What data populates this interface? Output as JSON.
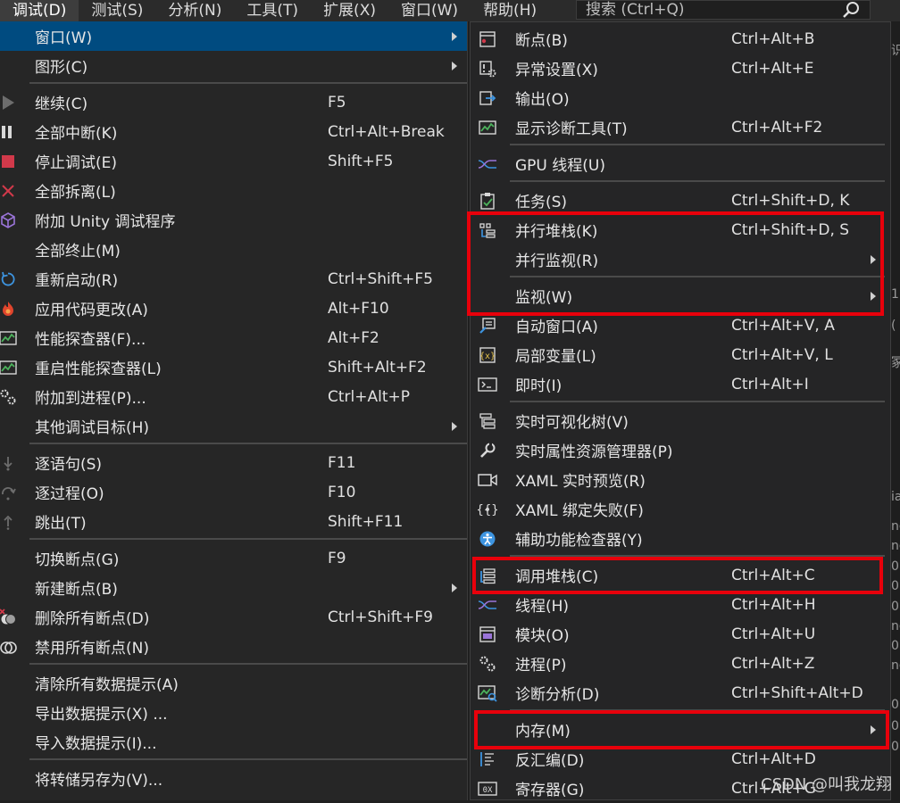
{
  "menubar": {
    "items": [
      {
        "label": "调试(D)",
        "active": true
      },
      {
        "label": "测试(S)"
      },
      {
        "label": "分析(N)"
      },
      {
        "label": "工具(T)"
      },
      {
        "label": "扩展(X)"
      },
      {
        "label": "窗口(W)"
      },
      {
        "label": "帮助(H)"
      }
    ],
    "search_placeholder": "搜索 (Ctrl+Q)"
  },
  "debug_menu": {
    "items": [
      {
        "label": "窗口(W)",
        "shortcut": "",
        "submenu": true,
        "highlight": true,
        "icon": ""
      },
      {
        "label": "图形(C)",
        "shortcut": "",
        "submenu": true,
        "icon": ""
      },
      {
        "label": "继续(C)",
        "shortcut": "F5",
        "icon": "play-icon"
      },
      {
        "label": "全部中断(K)",
        "shortcut": "Ctrl+Alt+Break",
        "icon": "pause-icon"
      },
      {
        "label": "停止调试(E)",
        "shortcut": "Shift+F5",
        "icon": "stop-icon"
      },
      {
        "label": "全部拆离(L)",
        "shortcut": "",
        "icon": "detach-icon"
      },
      {
        "label": "附加 Unity 调试程序",
        "shortcut": "",
        "icon": "unity-cube-icon"
      },
      {
        "label": "全部终止(M)",
        "shortcut": "",
        "icon": ""
      },
      {
        "label": "重新启动(R)",
        "shortcut": "Ctrl+Shift+F5",
        "icon": "restart-icon"
      },
      {
        "label": "应用代码更改(A)",
        "shortcut": "Alt+F10",
        "icon": "hot-reload-flame-icon"
      },
      {
        "label": "性能探查器(F)...",
        "shortcut": "Alt+F2",
        "icon": "profiler-chart-icon"
      },
      {
        "label": "重启性能探查器(L)",
        "shortcut": "Shift+Alt+F2",
        "icon": "profiler-chart-icon"
      },
      {
        "label": "附加到进程(P)...",
        "shortcut": "Ctrl+Alt+P",
        "icon": "gears-icon"
      },
      {
        "label": "其他调试目标(H)",
        "shortcut": "",
        "submenu": true,
        "icon": ""
      },
      {
        "label": "逐语句(S)",
        "shortcut": "F11",
        "icon": "step-into-icon"
      },
      {
        "label": "逐过程(O)",
        "shortcut": "F10",
        "icon": "step-over-icon"
      },
      {
        "label": "跳出(T)",
        "shortcut": "Shift+F11",
        "icon": "step-out-icon"
      },
      {
        "label": "切换断点(G)",
        "shortcut": "F9",
        "icon": ""
      },
      {
        "label": "新建断点(B)",
        "shortcut": "",
        "submenu": true,
        "icon": ""
      },
      {
        "label": "删除所有断点(D)",
        "shortcut": "Ctrl+Shift+F9",
        "icon": "delete-breakpoints-icon"
      },
      {
        "label": "禁用所有断点(N)",
        "shortcut": "",
        "icon": "disable-breakpoints-icon"
      },
      {
        "label": "清除所有数据提示(A)",
        "shortcut": "",
        "icon": ""
      },
      {
        "label": "导出数据提示(X) ...",
        "shortcut": "",
        "icon": ""
      },
      {
        "label": "导入数据提示(I)...",
        "shortcut": "",
        "icon": ""
      },
      {
        "label": "将转储另存为(V)...",
        "shortcut": "",
        "icon": ""
      }
    ]
  },
  "window_submenu": {
    "items": [
      {
        "label": "断点(B)",
        "shortcut": "Ctrl+Alt+B",
        "icon": "breakpoints-window-icon"
      },
      {
        "label": "异常设置(X)",
        "shortcut": "Ctrl+Alt+E",
        "icon": "exception-settings-icon"
      },
      {
        "label": "输出(O)",
        "shortcut": "",
        "icon": "output-icon"
      },
      {
        "label": "显示诊断工具(T)",
        "shortcut": "Ctrl+Alt+F2",
        "icon": "diagnostic-tools-icon"
      },
      {
        "label": "GPU 线程(U)",
        "shortcut": "",
        "icon": "gpu-threads-icon"
      },
      {
        "label": "任务(S)",
        "shortcut": "Ctrl+Shift+D, K",
        "icon": "tasks-clipboard-icon"
      },
      {
        "label": "并行堆栈(K)",
        "shortcut": "Ctrl+Shift+D, S",
        "icon": "parallel-stacks-icon"
      },
      {
        "label": "并行监视(R)",
        "shortcut": "",
        "submenu": true,
        "icon": ""
      },
      {
        "label": "监视(W)",
        "shortcut": "",
        "submenu": true,
        "icon": ""
      },
      {
        "label": "自动窗口(A)",
        "shortcut": "Ctrl+Alt+V, A",
        "icon": "autos-window-icon"
      },
      {
        "label": "局部变量(L)",
        "shortcut": "Ctrl+Alt+V, L",
        "icon": "locals-icon"
      },
      {
        "label": "即时(I)",
        "shortcut": "Ctrl+Alt+I",
        "icon": "immediate-window-icon"
      },
      {
        "label": "实时可视化树(V)",
        "shortcut": "",
        "icon": "live-visual-tree-icon"
      },
      {
        "label": "实时属性资源管理器(P)",
        "shortcut": "",
        "icon": "property-explorer-wrench-icon"
      },
      {
        "label": "XAML 实时预览(R)",
        "shortcut": "",
        "icon": "camera-preview-icon"
      },
      {
        "label": "XAML 绑定失败(F)",
        "shortcut": "",
        "icon": "binding-failures-icon"
      },
      {
        "label": "辅助功能检查器(Y)",
        "shortcut": "",
        "icon": "accessibility-icon"
      },
      {
        "label": "调用堆栈(C)",
        "shortcut": "Ctrl+Alt+C",
        "icon": "call-stack-icon"
      },
      {
        "label": "线程(H)",
        "shortcut": "Ctrl+Alt+H",
        "icon": "threads-icon"
      },
      {
        "label": "模块(O)",
        "shortcut": "Ctrl+Alt+U",
        "icon": "modules-icon"
      },
      {
        "label": "进程(P)",
        "shortcut": "Ctrl+Alt+Z",
        "icon": "processes-gears-icon"
      },
      {
        "label": "诊断分析(D)",
        "shortcut": "Ctrl+Shift+Alt+D",
        "icon": "diagnostic-analysis-icon"
      },
      {
        "label": "内存(M)",
        "shortcut": "",
        "submenu": true,
        "icon": ""
      },
      {
        "label": "反汇编(D)",
        "shortcut": "Ctrl+Alt+D",
        "icon": "disassembly-icon"
      },
      {
        "label": "寄存器(G)",
        "shortcut": "Ctrl+Alt+G",
        "icon": "registers-icon"
      }
    ]
  },
  "edge_text": [
    "识",
    "1",
    "(",
    "冢",
    "ia",
    "nc",
    "nc",
    "0",
    "0",
    "0",
    "nc",
    "0",
    "nc",
    "0",
    "0",
    "0"
  ],
  "watermark": "CSDN @叫我龙翔",
  "colors": {
    "highlight": "#004b80",
    "annotation": "#e8000b"
  }
}
